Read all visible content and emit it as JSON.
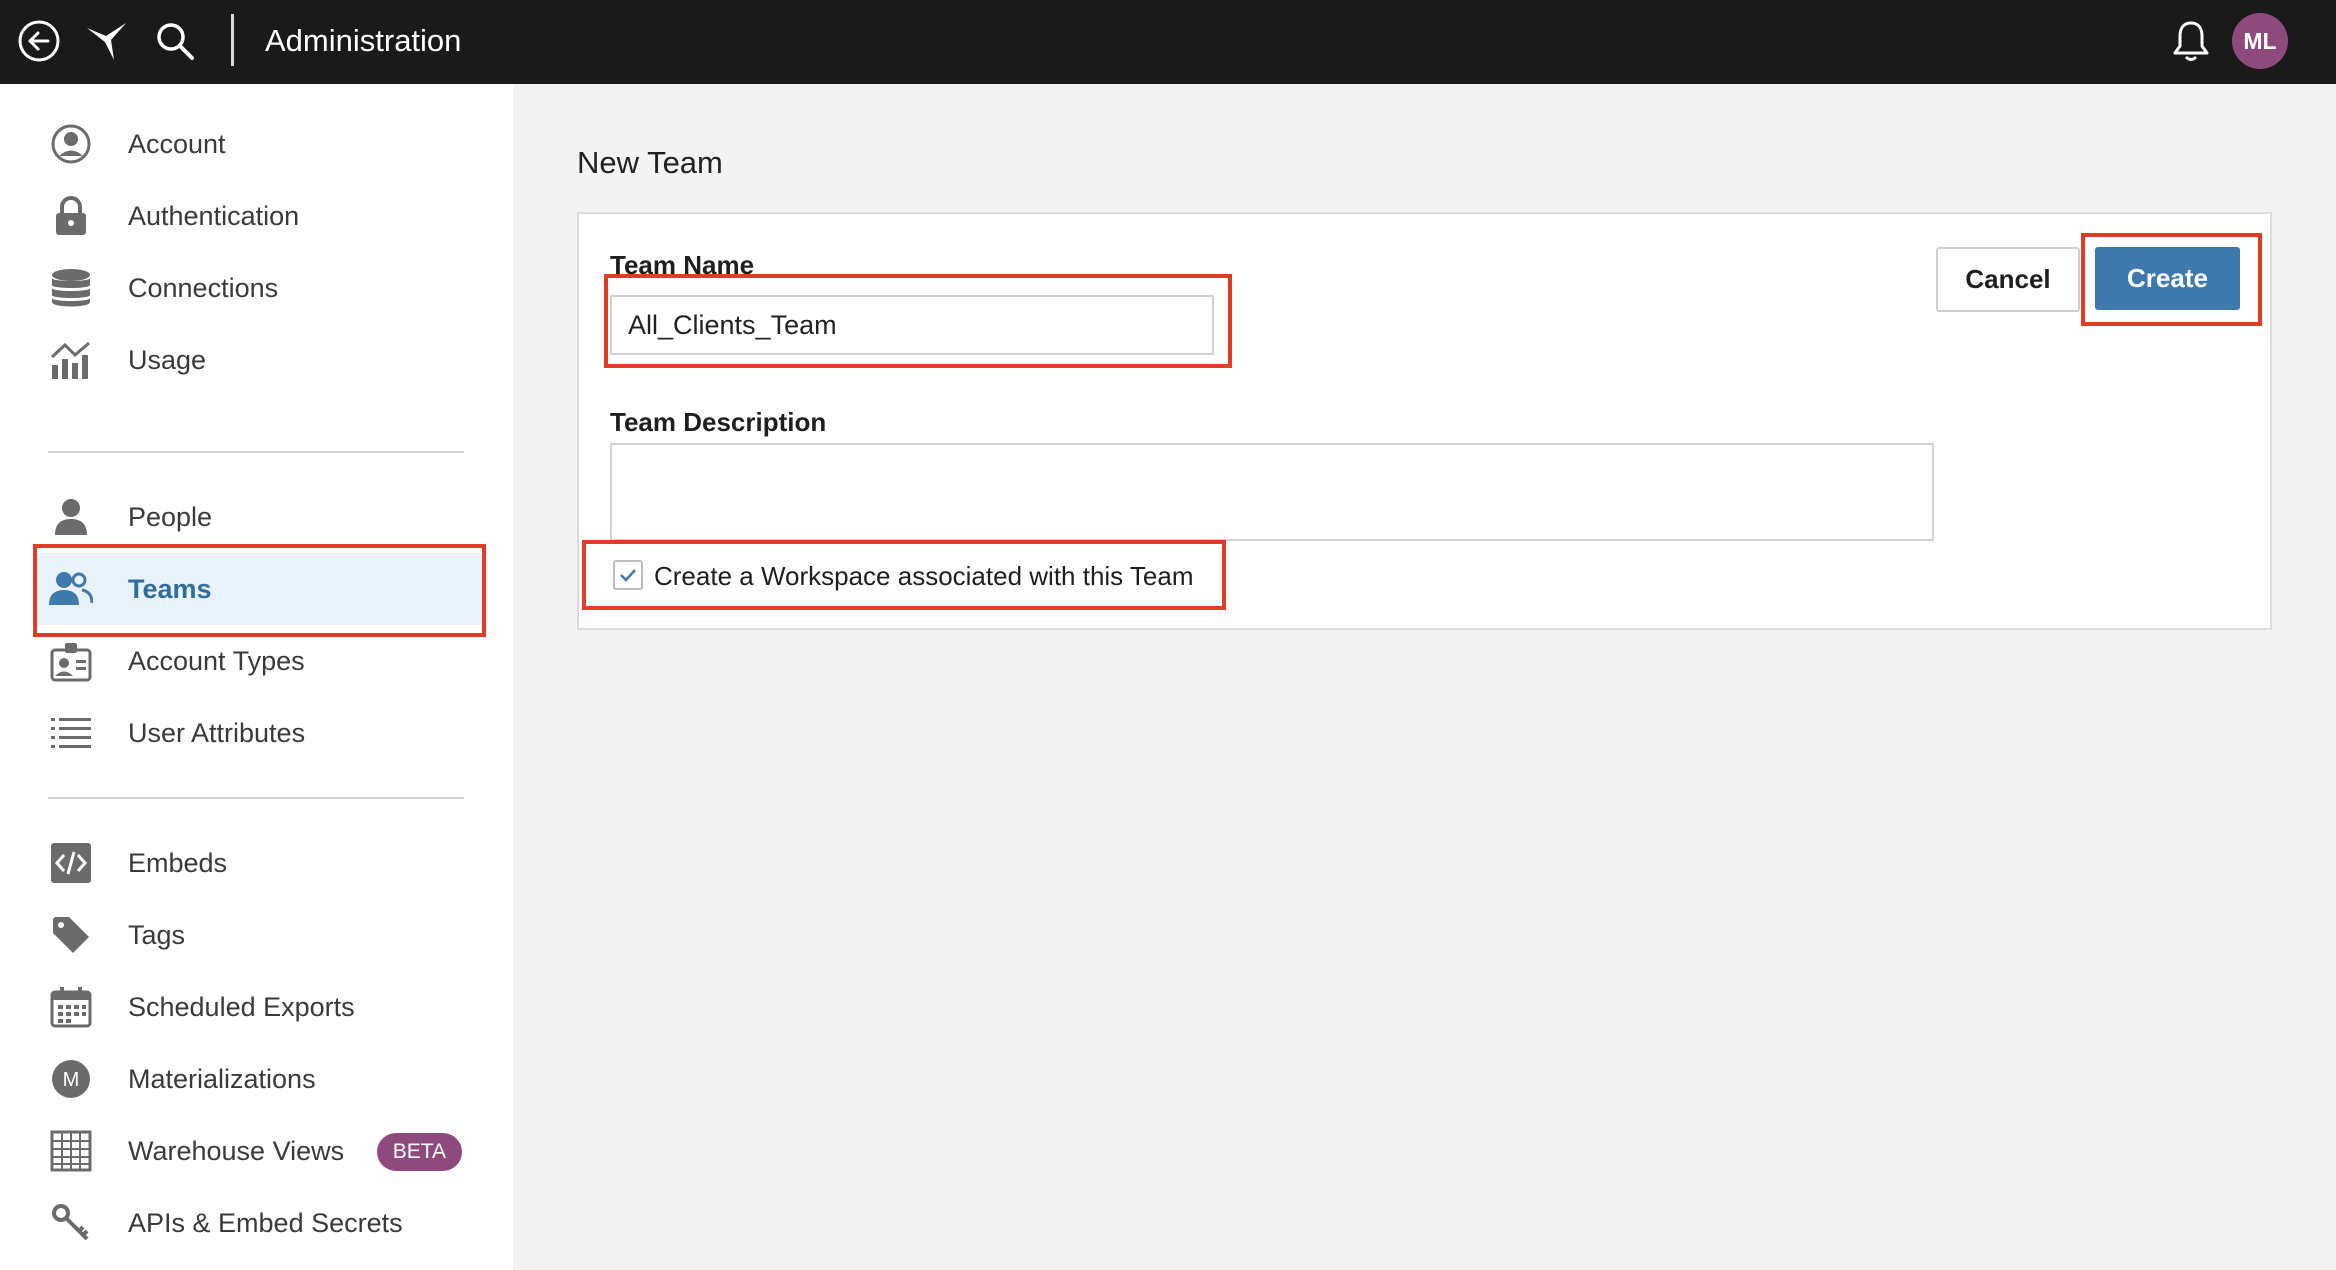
{
  "colors": {
    "topbar_bg": "#1a1a1a",
    "accent_blue": "#3f79ad",
    "active_nav_text": "#2f6d9e",
    "avatar_bg": "#8e4a7c",
    "beta_bg": "#8e4a7c",
    "highlight_red": "#e03c28"
  },
  "topbar": {
    "title": "Administration",
    "icons": [
      "back-icon",
      "logo-icon",
      "search-icon",
      "bell-icon"
    ],
    "avatar_initials": "ML"
  },
  "sidebar": {
    "group1": [
      {
        "label": "Account",
        "icon": "account-circle-icon"
      },
      {
        "label": "Authentication",
        "icon": "lock-icon"
      },
      {
        "label": "Connections",
        "icon": "database-icon"
      },
      {
        "label": "Usage",
        "icon": "usage-chart-icon"
      }
    ],
    "group2": [
      {
        "label": "People",
        "icon": "person-icon"
      },
      {
        "label": "Teams",
        "icon": "team-icon",
        "active": true
      },
      {
        "label": "Account Types",
        "icon": "id-badge-icon"
      },
      {
        "label": "User Attributes",
        "icon": "list-icon"
      }
    ],
    "group3": [
      {
        "label": "Embeds",
        "icon": "code-icon"
      },
      {
        "label": "Tags",
        "icon": "tag-icon"
      },
      {
        "label": "Scheduled Exports",
        "icon": "calendar-icon"
      },
      {
        "label": "Materializations",
        "icon": "materialization-icon"
      },
      {
        "label": "Warehouse Views",
        "icon": "table-icon",
        "badge": "BETA"
      },
      {
        "label": "APIs & Embed Secrets",
        "icon": "key-icon"
      }
    ]
  },
  "main": {
    "page_title": "New Team",
    "form": {
      "team_name_label": "Team Name",
      "team_name_value": "All_Clients_Team",
      "team_description_label": "Team Description",
      "team_description_value": "",
      "workspace_checkbox_label": "Create a Workspace associated with this Team",
      "workspace_checkbox_checked": true,
      "cancel_label": "Cancel",
      "create_label": "Create"
    }
  }
}
